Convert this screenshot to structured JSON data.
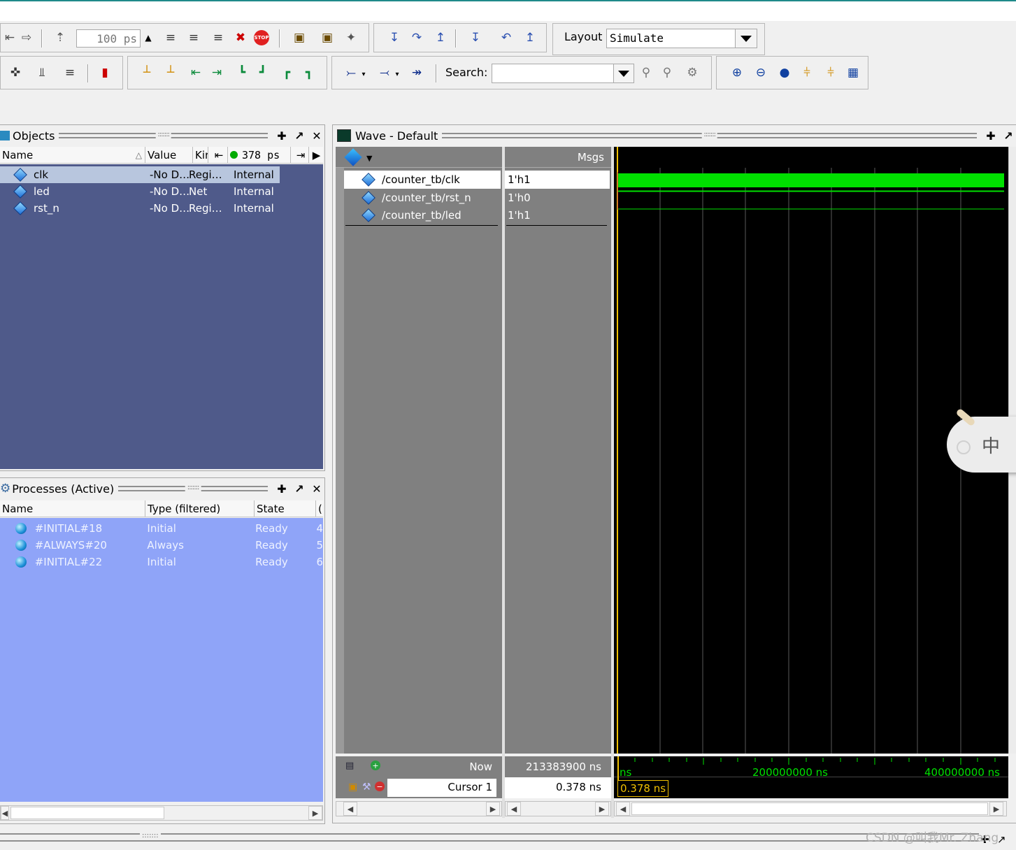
{
  "toolbar": {
    "run_length_value": "100 ps",
    "layout_label": "Layout",
    "layout_value": "Simulate",
    "search_label": "Search:",
    "search_value": ""
  },
  "objects": {
    "title": "Objects",
    "columns": [
      "Name",
      "Value",
      "Kir",
      "378 ps"
    ],
    "rows": [
      {
        "name": "clk",
        "value": "-No D…",
        "kind": "Regi…",
        "mode": "Internal"
      },
      {
        "name": "led",
        "value": "-No D…",
        "kind": "Net",
        "mode": "Internal"
      },
      {
        "name": "rst_n",
        "value": "-No D…",
        "kind": "Regi…",
        "mode": "Internal"
      }
    ]
  },
  "processes": {
    "title": "Processes (Active)",
    "columns": [
      "Name",
      "Type (filtered)",
      "State",
      "("
    ],
    "rows": [
      {
        "name": "#INITIAL#18",
        "type": "Initial",
        "state": "Ready",
        "extra": "4"
      },
      {
        "name": "#ALWAYS#20",
        "type": "Always",
        "state": "Ready",
        "extra": "5"
      },
      {
        "name": "#INITIAL#22",
        "type": "Initial",
        "state": "Ready",
        "extra": "6"
      }
    ]
  },
  "wave": {
    "title": "Wave - Default",
    "msgs_label": "Msgs",
    "signals": [
      {
        "name": "/counter_tb/clk",
        "value": "1'h1"
      },
      {
        "name": "/counter_tb/rst_n",
        "value": "1'h0"
      },
      {
        "name": "/counter_tb/led",
        "value": "1'h1"
      }
    ],
    "now_label": "Now",
    "now_value": "213383900 ns",
    "cursor_label": "Cursor 1",
    "cursor_value": "0.378 ns",
    "time_ticks": [
      "ns",
      "200000000 ns",
      "400000000 ns"
    ],
    "cursor_badge": "0.378 ns"
  },
  "ime_label": "中",
  "watermark": "CSDN @叫我Mr. Zhang",
  "colors": {
    "objects_bg": "#4f5a8a",
    "processes_bg": "#8fa4f8",
    "wave_bg": "#000000",
    "signal_green": "#00e000",
    "cursor_yellow": "#f0c000"
  }
}
